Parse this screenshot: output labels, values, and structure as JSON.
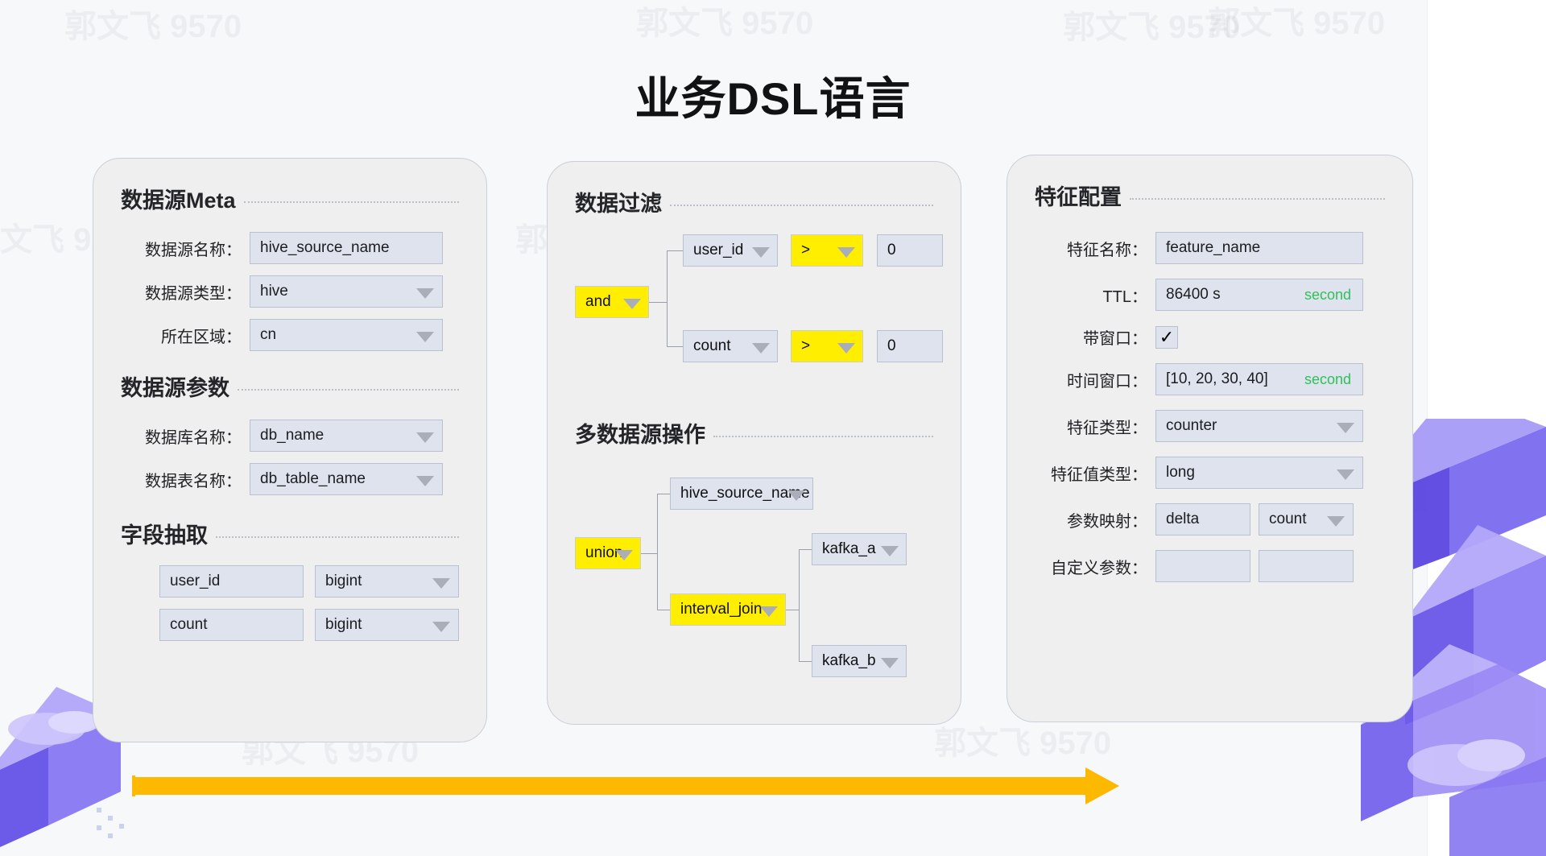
{
  "title": "业务DSL语言",
  "watermark": "郭文飞 9570",
  "panels": {
    "source": {
      "sections": [
        {
          "heading": "数据源Meta"
        },
        {
          "heading": "数据源参数"
        },
        {
          "heading": "字段抽取"
        }
      ],
      "meta_fields": [
        {
          "label": "数据源名称：",
          "value": "hive_source_name",
          "control": "input"
        },
        {
          "label": "数据源类型：",
          "value": "hive",
          "control": "select"
        },
        {
          "label": "所在区域：",
          "value": "cn",
          "control": "select"
        }
      ],
      "param_fields": [
        {
          "label": "数据库名称：",
          "value": "db_name",
          "control": "select"
        },
        {
          "label": "数据表名称：",
          "value": "db_table_name",
          "control": "select"
        }
      ],
      "extract_fields": [
        {
          "name": "user_id",
          "type": "bigint"
        },
        {
          "name": "count",
          "type": "bigint"
        }
      ]
    },
    "filter": {
      "sections": [
        {
          "heading": "数据过滤"
        },
        {
          "heading": "多数据源操作"
        }
      ],
      "filter_tree": {
        "root": "and",
        "conditions": [
          {
            "field": "user_id",
            "operator": ">",
            "value": "0"
          },
          {
            "field": "count",
            "operator": ">",
            "value": "0"
          }
        ]
      },
      "source_tree": {
        "root": "union",
        "children": [
          {
            "label": "hive_source_name",
            "kind": "source"
          },
          {
            "label": "interval_join",
            "kind": "op",
            "children": [
              {
                "label": "kafka_a",
                "kind": "source"
              },
              {
                "label": "kafka_b",
                "kind": "source"
              }
            ]
          }
        ]
      }
    },
    "feature": {
      "sections": [
        {
          "heading": "特征配置"
        }
      ],
      "fields": [
        {
          "label": "特征名称：",
          "value": "feature_name",
          "control": "input",
          "unit": ""
        },
        {
          "label": "TTL：",
          "value": "86400 s",
          "control": "input",
          "unit": "second"
        },
        {
          "label": "带窗口：",
          "value": "✓",
          "control": "checkbox",
          "unit": ""
        },
        {
          "label": "时间窗口：",
          "value": "[10, 20, 30, 40]",
          "control": "input",
          "unit": "second"
        },
        {
          "label": "特征类型：",
          "value": "counter",
          "control": "select",
          "unit": ""
        },
        {
          "label": "特征值类型：",
          "value": "long",
          "control": "select",
          "unit": ""
        }
      ],
      "param_map": {
        "label": "参数映射：",
        "key": "delta",
        "value": "count"
      },
      "custom_param": {
        "label": "自定义参数：",
        "key": "",
        "value": ""
      }
    }
  },
  "colors": {
    "background": "#f7f8fa",
    "panel": "#efefef",
    "control": "#dfe3ed",
    "operator": "#ffee00",
    "arrow": "#fcb900",
    "unit_text": "#2fc05a"
  }
}
